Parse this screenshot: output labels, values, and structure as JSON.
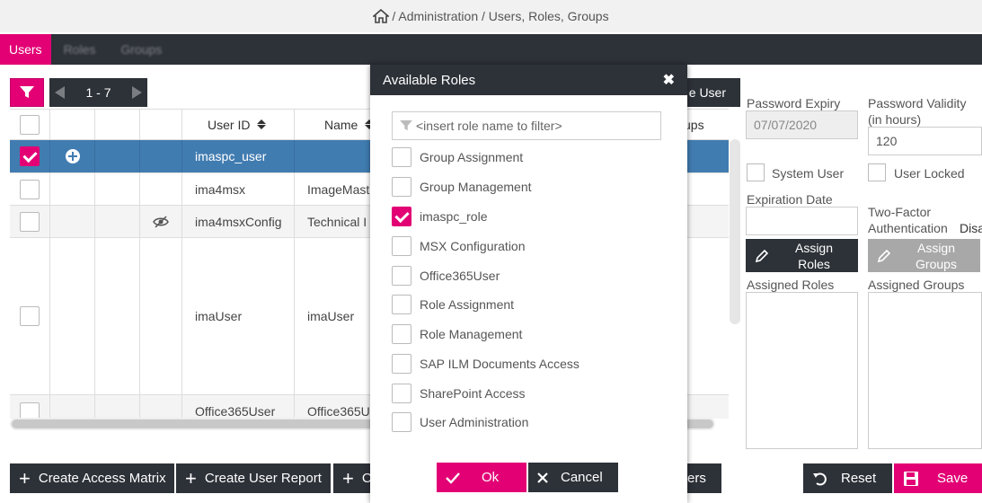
{
  "breadcrumb": {
    "path": "/ Administration / Users, Roles, Groups"
  },
  "tabs": [
    {
      "label": "Users",
      "active": true
    },
    {
      "label": "Roles",
      "active": false
    },
    {
      "label": "Groups",
      "active": false
    }
  ],
  "pager": {
    "range": "1 - 7"
  },
  "table": {
    "headers": {
      "user_id": "User ID",
      "name": "Name",
      "groups_partial": "ups"
    },
    "rows": [
      {
        "user_id": "imaspc_user",
        "name": "",
        "selected": true
      },
      {
        "user_id": "ima4msx",
        "name": "ImageMast"
      },
      {
        "user_id": "ima4msxConfig",
        "name": "Technical I"
      },
      {
        "user_id": "imaUser",
        "name": "imaUser"
      },
      {
        "user_id": "Office365User",
        "name": "Office365U"
      }
    ]
  },
  "behind_button_partial": "e User",
  "form": {
    "password_expiry_label": "Password Expiry",
    "password_expiry_value": "07/07/2020",
    "password_validity_label_1": "Password Validity",
    "password_validity_label_2": "(in hours)",
    "password_validity_value": "120",
    "system_user_label": "System User",
    "user_locked_label": "User Locked",
    "expiration_date_label": "Expiration Date",
    "two_factor_label_1": "Two-Factor",
    "two_factor_label_2": "Authentication",
    "two_factor_value_partial": "Disa",
    "assign_roles_1": "Assign",
    "assign_roles_2": "Roles",
    "assign_groups_1": "Assign",
    "assign_groups_2": "Groups",
    "assigned_roles_label": "Assigned Roles",
    "assigned_groups_label": "Assigned Groups"
  },
  "bottom": {
    "create_access_matrix": "Create Access Matrix",
    "create_user_report": "Create User Report",
    "third_partial": "C",
    "fourth_partial": "ers",
    "reset": "Reset",
    "save": "Save"
  },
  "modal": {
    "title": "Available Roles",
    "close": "✖",
    "filter_placeholder": "<insert role name to filter>",
    "roles": [
      {
        "label": "Group Assignment",
        "checked": false
      },
      {
        "label": "Group Management",
        "checked": false
      },
      {
        "label": "imaspc_role",
        "checked": true
      },
      {
        "label": "MSX Configuration",
        "checked": false
      },
      {
        "label": "Office365User",
        "checked": false
      },
      {
        "label": "Role Assignment",
        "checked": false
      },
      {
        "label": "Role Management",
        "checked": false
      },
      {
        "label": "SAP ILM Documents Access",
        "checked": false
      },
      {
        "label": "SharePoint Access",
        "checked": false
      },
      {
        "label": "User Administration",
        "checked": false
      }
    ],
    "ok": "Ok",
    "cancel": "Cancel"
  },
  "colors": {
    "accent": "#e20074",
    "dark": "#2d3138",
    "selected_row": "#417cb1"
  }
}
